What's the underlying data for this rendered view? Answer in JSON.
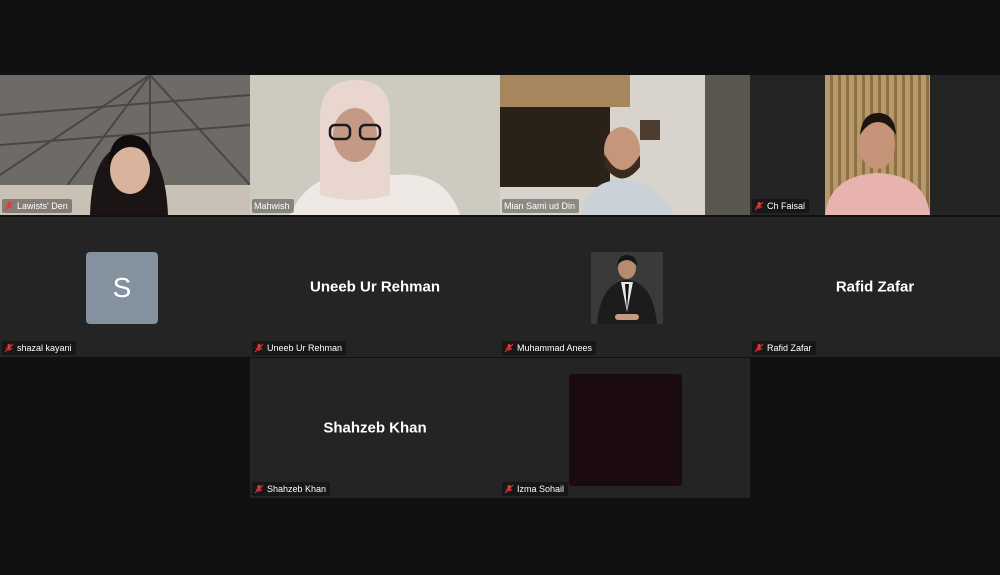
{
  "meeting": {
    "participants": [
      {
        "id": "p1",
        "name": "Lawists' Den",
        "type": "video"
      },
      {
        "id": "p2",
        "name": "Mahwish",
        "type": "video"
      },
      {
        "id": "p3",
        "name": "Mian Sami ud Din",
        "type": "video",
        "active_speaker": true
      },
      {
        "id": "p4",
        "name": "Ch Faisal",
        "type": "video"
      },
      {
        "id": "p5",
        "name": "shazal kayani",
        "type": "avatar",
        "avatar_letter": "S"
      },
      {
        "id": "p6",
        "name": "Uneeb Ur Rehman",
        "type": "name",
        "display_name": "Uneeb Ur Rehman"
      },
      {
        "id": "p7",
        "name": "Muhammad Anees",
        "type": "photo"
      },
      {
        "id": "p8",
        "name": "Rafid Zafar",
        "type": "name",
        "display_name": "Rafid Zafar"
      },
      {
        "id": "p9",
        "name": "Shahzeb Khan",
        "type": "name",
        "display_name": "Shahzeb Khan"
      },
      {
        "id": "p10",
        "name": "Izma Sohail",
        "type": "video_dark"
      }
    ]
  },
  "colors": {
    "background": "#111111",
    "tile": "#242424",
    "active_border": "#2ecc71",
    "mic_muted": "#e53935"
  }
}
